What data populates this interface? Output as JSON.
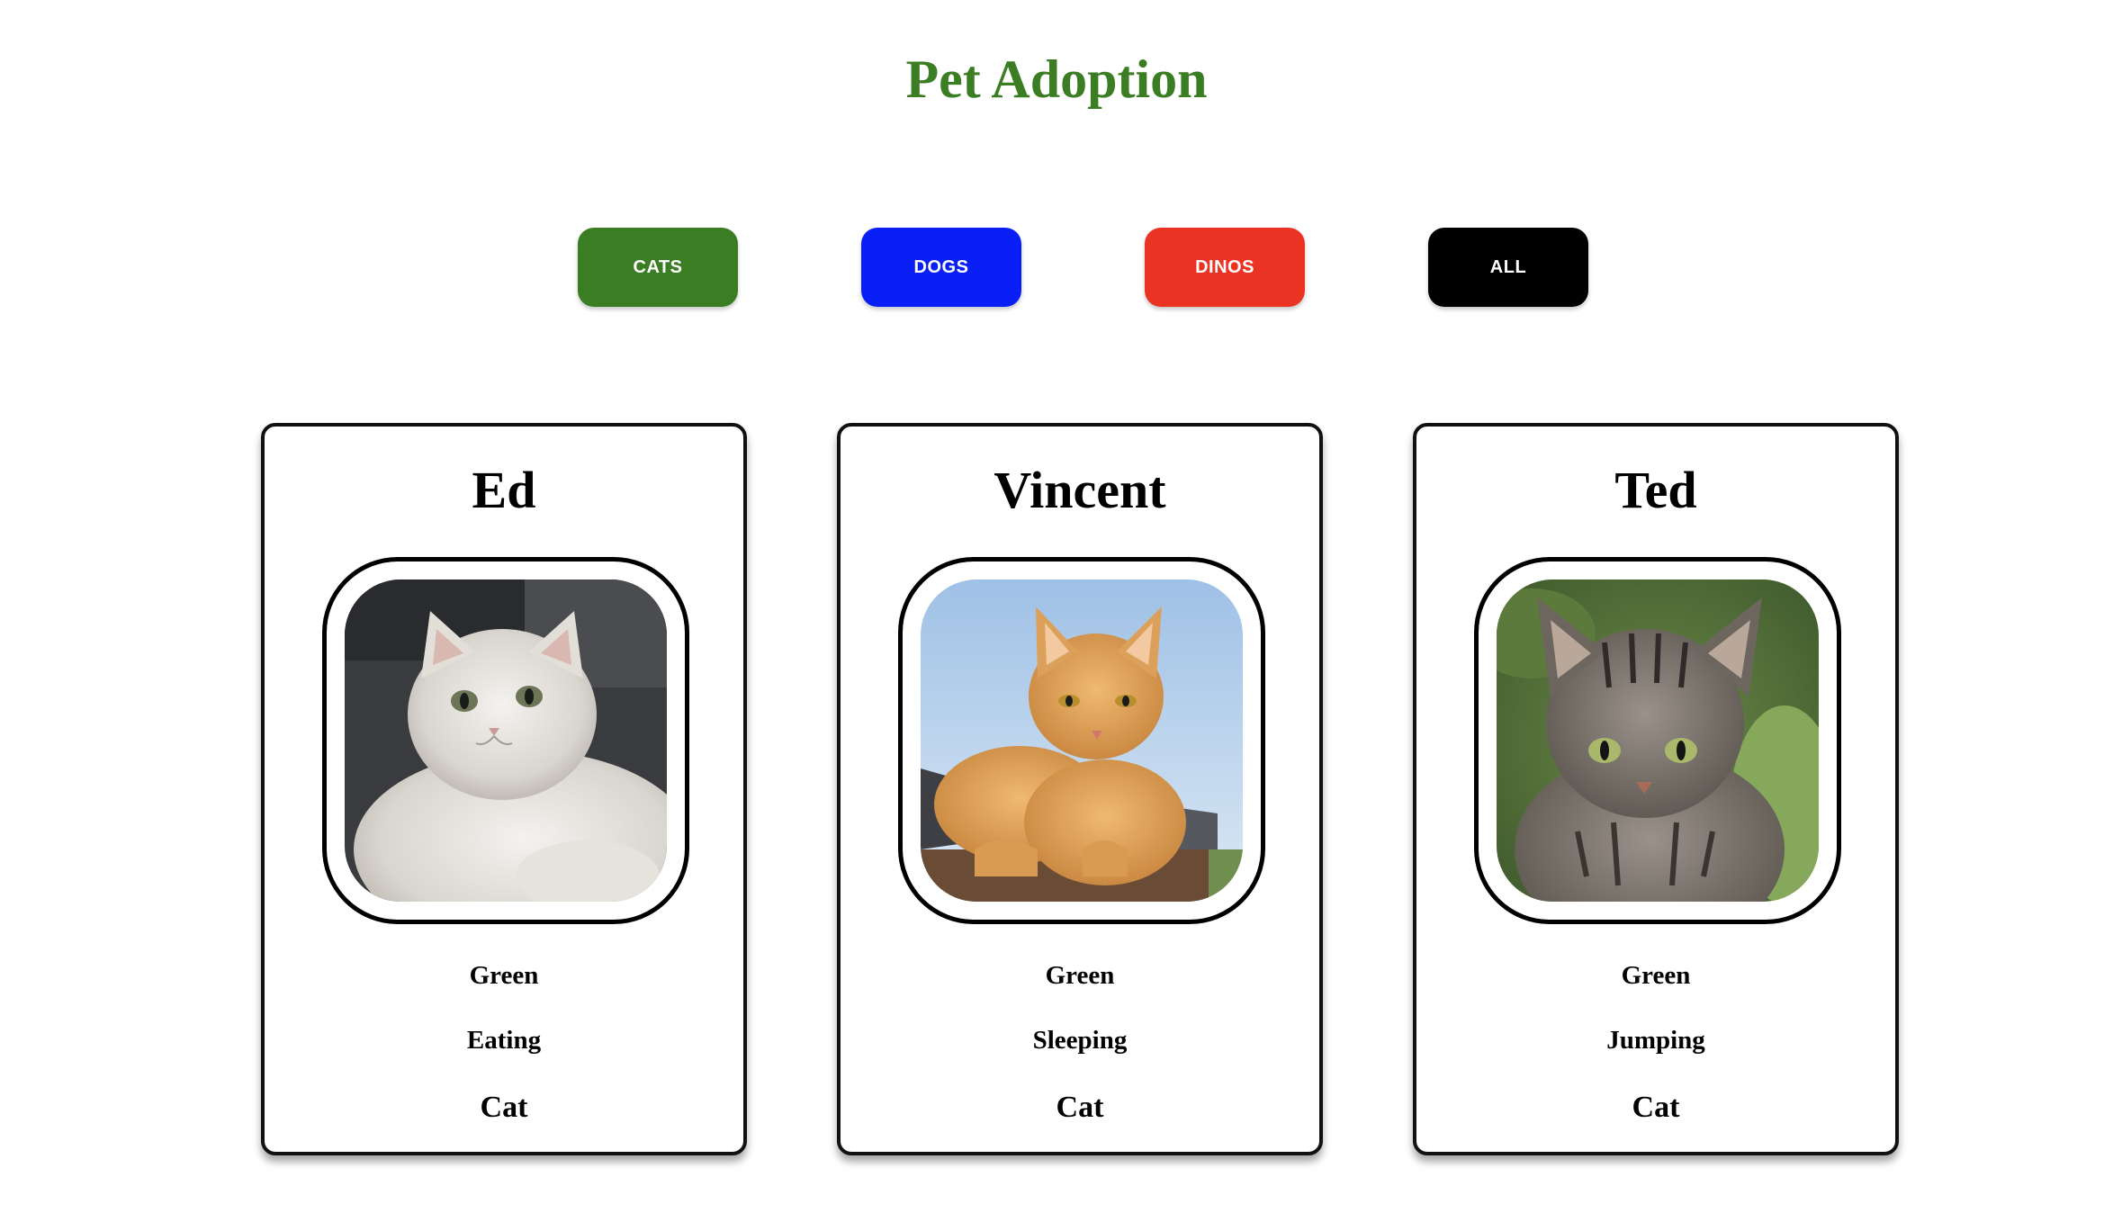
{
  "page": {
    "title": "Pet Adoption",
    "title_color": "#3a7d22"
  },
  "filters": [
    {
      "label": "CATS",
      "color": "#3a7d22"
    },
    {
      "label": "DOGS",
      "color": "#0a1ff5"
    },
    {
      "label": "DINOS",
      "color": "#ea3323"
    },
    {
      "label": "ALL",
      "color": "#000000"
    }
  ],
  "pets": [
    {
      "name": "Ed",
      "color": "Green",
      "activity": "Eating",
      "type": "Cat",
      "photo": "white-persian-cat"
    },
    {
      "name": "Vincent",
      "color": "Green",
      "activity": "Sleeping",
      "type": "Cat",
      "photo": "orange-tabby-cat"
    },
    {
      "name": "Ted",
      "color": "Green",
      "activity": "Jumping",
      "type": "Cat",
      "photo": "gray-tabby-kitten"
    }
  ]
}
